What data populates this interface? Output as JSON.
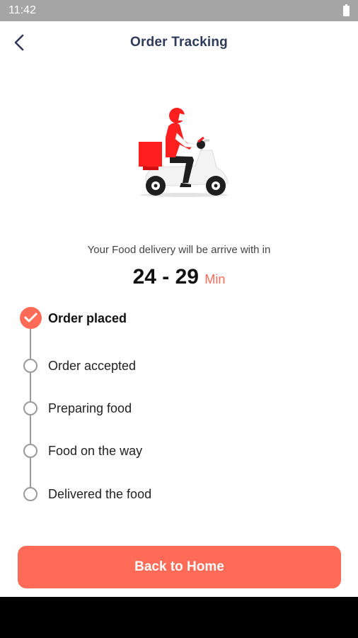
{
  "status_bar": {
    "time": "11:42"
  },
  "header": {
    "title": "Order Tracking",
    "back_icon": "chevron-left-icon"
  },
  "illustration": {
    "icon": "delivery-scooter-rider",
    "accent": "#ff1f1f"
  },
  "delivery": {
    "message": "Your Food delivery will be arrive with in",
    "eta_range": "24 - 29",
    "eta_unit": "Min"
  },
  "steps": [
    {
      "label": "Order placed",
      "completed": true
    },
    {
      "label": "Order accepted",
      "completed": false
    },
    {
      "label": "Preparing food",
      "completed": false
    },
    {
      "label": "Food on the way",
      "completed": false
    },
    {
      "label": "Delivered the food",
      "completed": false
    }
  ],
  "actions": {
    "back_to_home": "Back to Home"
  },
  "colors": {
    "accent": "#ff6b57",
    "title": "#2e3a59",
    "timeline": "#9a9a9a",
    "status_bar": "#a5a5a5"
  }
}
